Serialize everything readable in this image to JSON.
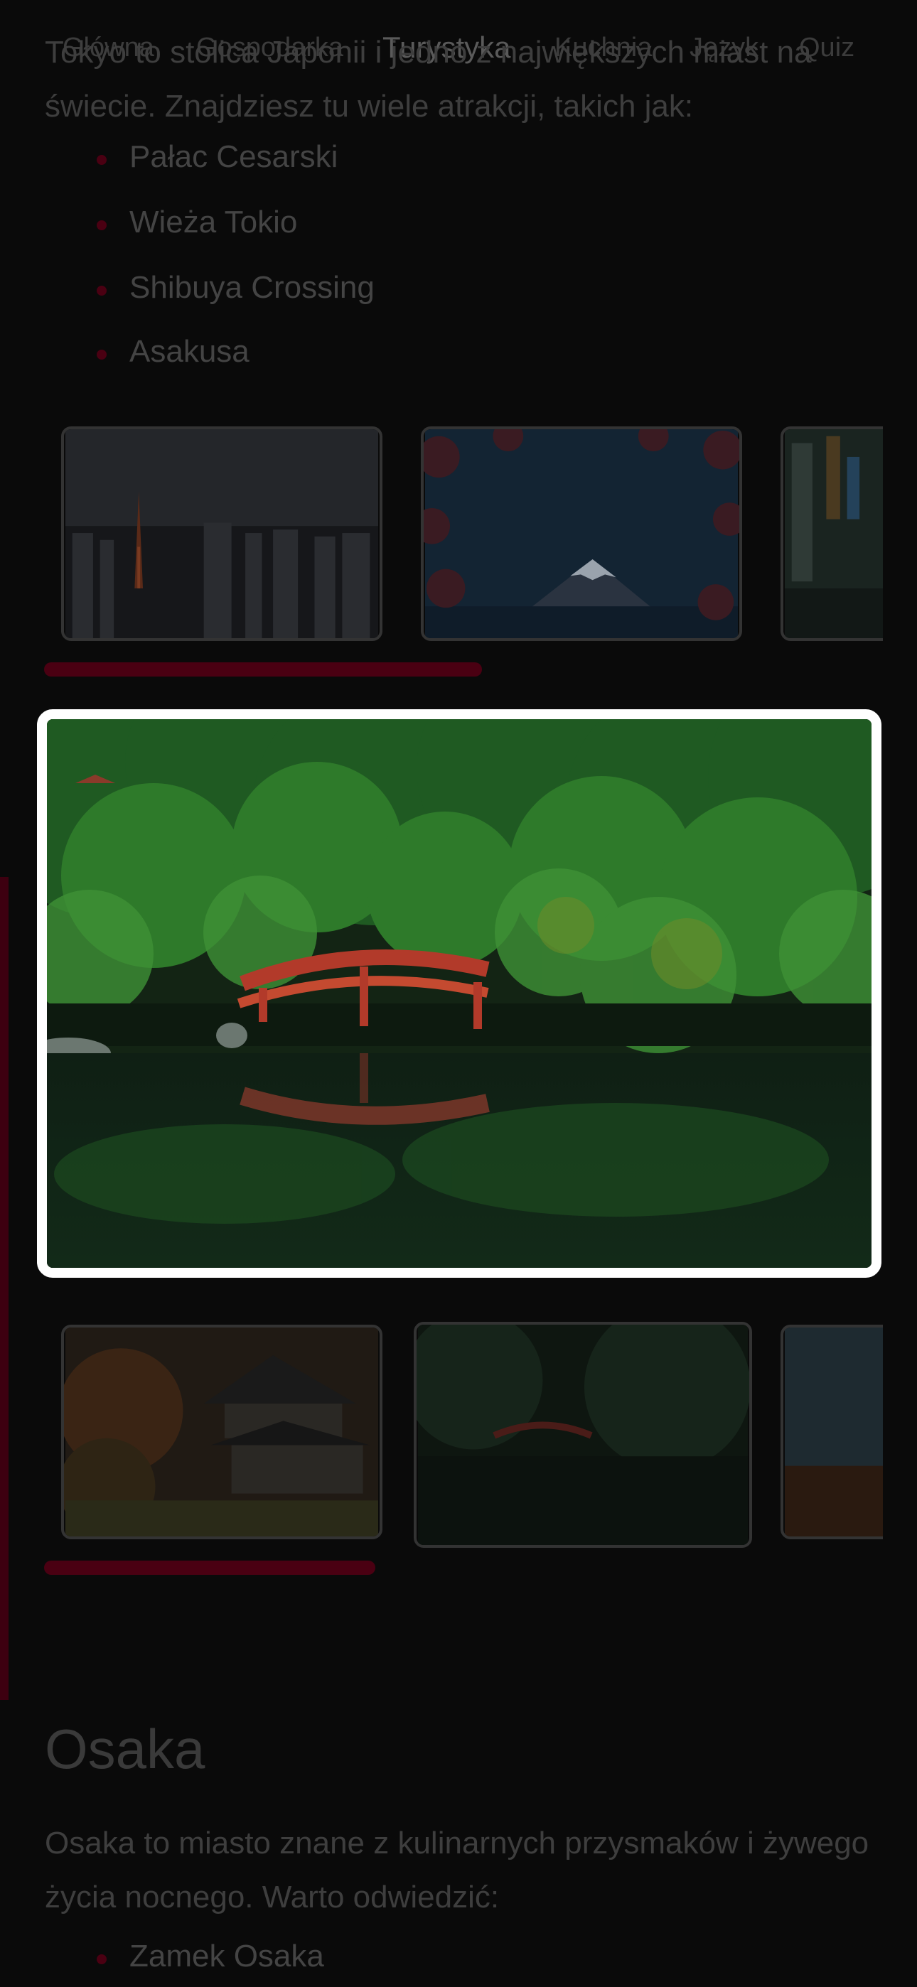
{
  "nav": {
    "items": [
      {
        "label": "Główna"
      },
      {
        "label": "Gospodarka"
      },
      {
        "label": "Turystyka",
        "active": true
      },
      {
        "label": "Kuchnia"
      },
      {
        "label": "Język"
      },
      {
        "label": "Quiz"
      }
    ]
  },
  "tokyo": {
    "intro": "Tokyo to stolica Japonii i jedno z największych miast na świecie. Znajdziesz tu wiele atrakcji, takich jak:",
    "attractions": [
      "Pałac Cesarski",
      "Wieża Tokio",
      "Shibuya Crossing",
      "Asakusa"
    ],
    "carousel_progress": 0.29
  },
  "lightbox": {
    "icon": "bridge-photo",
    "border_color": "#ffffff"
  },
  "kyoto": {
    "carousel_progress": 0.22
  },
  "osaka": {
    "title": "Osaka",
    "intro": "Osaka to miasto znane z kulinarnych przysmaków i żywego życia nocnego. Warto odwiedzić:",
    "attractions": [
      "Zamek Osaka"
    ]
  },
  "colors": {
    "accent": "#5c0018",
    "background": "#0a0a0a"
  }
}
